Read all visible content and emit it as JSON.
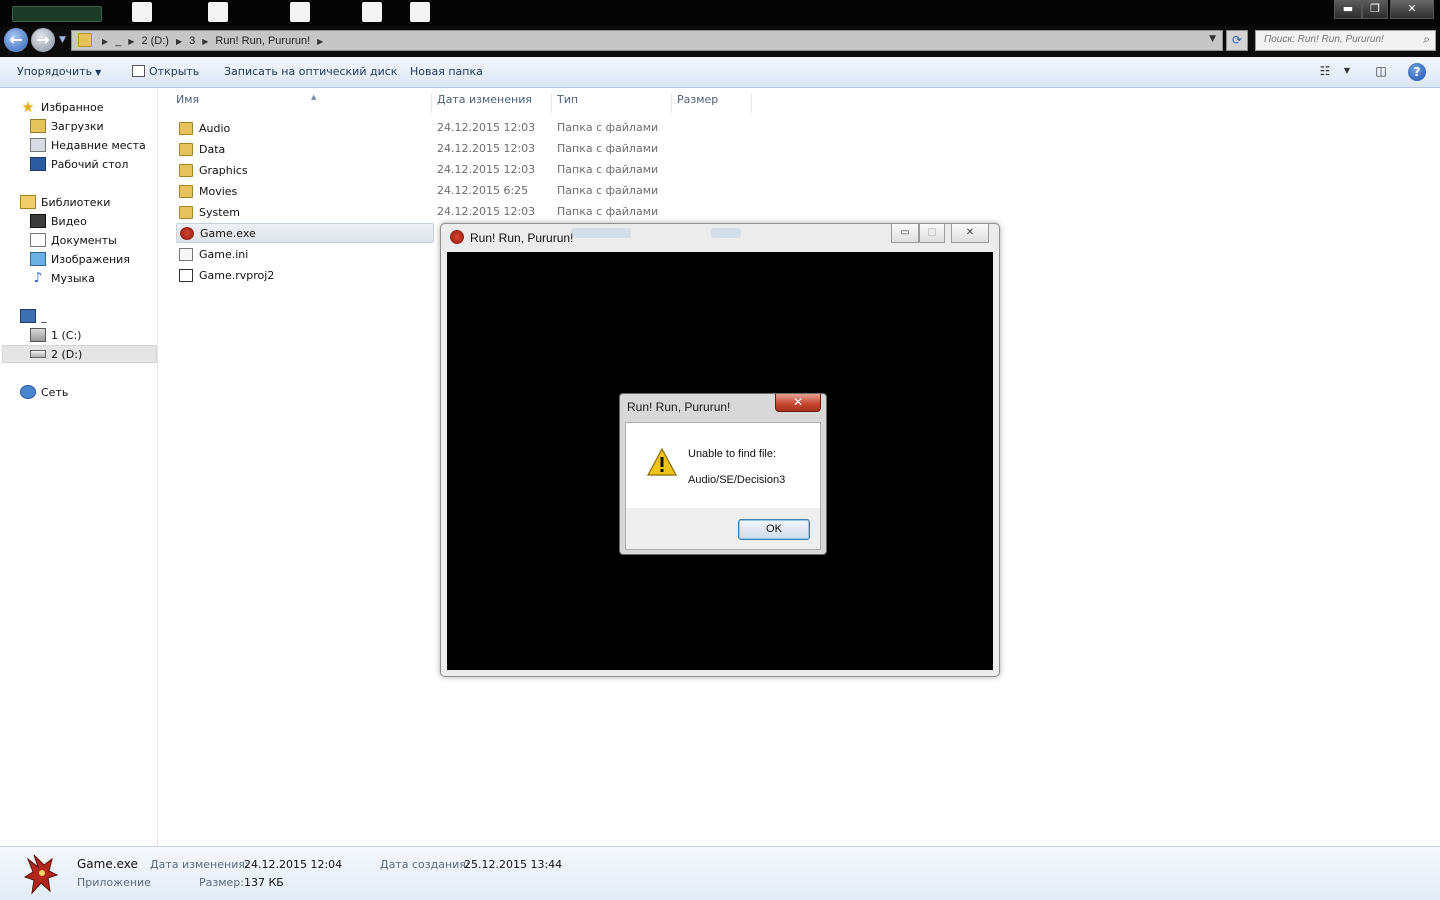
{
  "address": {
    "crumbs": [
      "_",
      "2 (D:)",
      "3",
      "Run! Run, Pururun!"
    ],
    "search_placeholder": "Поиск: Run! Run, Pururun!"
  },
  "toolbar": {
    "organize": "Упорядочить",
    "open": "Открыть",
    "burn": "Записать на оптический диск",
    "new_folder": "Новая папка"
  },
  "nav": {
    "favorites": "Избранное",
    "downloads": "Загрузки",
    "recent": "Недавние места",
    "desktop": "Рабочий стол",
    "libraries": "Библиотеки",
    "video": "Видео",
    "documents": "Документы",
    "images": "Изображения",
    "music": "Музыка",
    "computer": "_",
    "drive_c": "1 (C:)",
    "drive_d": "2 (D:)",
    "network": "Сеть"
  },
  "columns": {
    "name": "Имя",
    "date": "Дата изменения",
    "type": "Тип",
    "size": "Размер"
  },
  "files": [
    {
      "name": "Audio",
      "date": "24.12.2015 12:03",
      "type": "Папка с файлами",
      "icon": "folder"
    },
    {
      "name": "Data",
      "date": "24.12.2015 12:03",
      "type": "Папка с файлами",
      "icon": "folder"
    },
    {
      "name": "Graphics",
      "date": "24.12.2015 12:03",
      "type": "Папка с файлами",
      "icon": "folder"
    },
    {
      "name": "Movies",
      "date": "24.12.2015 6:25",
      "type": "Папка с файлами",
      "icon": "folder"
    },
    {
      "name": "System",
      "date": "24.12.2015 12:03",
      "type": "Папка с файлами",
      "icon": "folder"
    },
    {
      "name": "Game.exe",
      "date": "",
      "type": "",
      "icon": "exe"
    },
    {
      "name": "Game.ini",
      "date": "",
      "type": "",
      "icon": "ini"
    },
    {
      "name": "Game.rvproj2",
      "date": "",
      "type": "",
      "icon": "proj"
    }
  ],
  "game_window": {
    "title": "Run! Run, Pururun!"
  },
  "dialog": {
    "title": "Run! Run, Pururun!",
    "message_line1": "Unable to find file:",
    "message_line2": "Audio/SE/Decision3",
    "ok_label": "OK"
  },
  "details": {
    "name": "Game.exe",
    "kind": "Приложение",
    "modified_label": "Дата изменения:",
    "modified_value": "24.12.2015 12:04",
    "size_label": "Размер:",
    "size_value": "137 КБ",
    "created_label": "Дата создания:",
    "created_value": "25.12.2015 13:44"
  },
  "colors": {
    "toolbar_text": "#1e395b",
    "selection": "#dde3ea",
    "dialog_close": "#c84a32"
  }
}
